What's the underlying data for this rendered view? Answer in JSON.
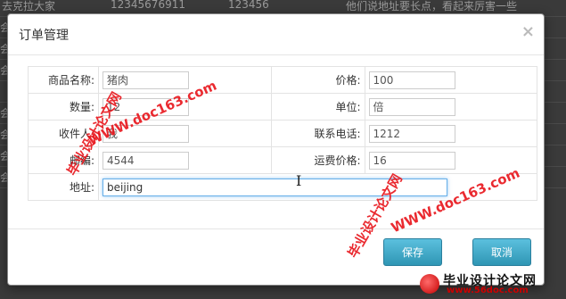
{
  "background_rows": [
    {
      "c1": "去克拉大家",
      "c2": "12345676911",
      "c3": "123456",
      "c4": "他们说地址要长点，看起来厉害一些"
    },
    {
      "c1": "会",
      "c2": "",
      "c3": "",
      "c4": ""
    },
    {
      "c1": "会",
      "c2": "",
      "c3": "",
      "c4": ""
    },
    {
      "c1": "会",
      "c2": "",
      "c3": "",
      "c4": ""
    },
    {
      "c1": "",
      "c2": "",
      "c3": "",
      "c4": ""
    },
    {
      "c1": "会",
      "c2": "",
      "c3": "",
      "c4": ""
    },
    {
      "c1": "会",
      "c2": "",
      "c3": "",
      "c4": ""
    },
    {
      "c1": "会",
      "c2": "",
      "c3": "",
      "c4": ""
    },
    {
      "c1": "会",
      "c2": "",
      "c3": "",
      "c4": ""
    }
  ],
  "modal": {
    "title": "订单管理",
    "close_glyph": "×",
    "form": {
      "product_name": {
        "label": "商品名称:",
        "value": "猪肉"
      },
      "price": {
        "label": "价格:",
        "value": "100"
      },
      "quantity": {
        "label": "数量:",
        "value": "12"
      },
      "unit": {
        "label": "单位:",
        "value": "倍"
      },
      "recipient": {
        "label": "收件人:",
        "value": "我"
      },
      "phone": {
        "label": "联系电话:",
        "value": "1212"
      },
      "postcode": {
        "label": "邮编:",
        "value": "4544"
      },
      "shipping": {
        "label": "运费价格:",
        "value": "16"
      },
      "address": {
        "label": "地址:",
        "value": "beijing"
      }
    },
    "buttons": {
      "save": "保存",
      "cancel": "取消"
    }
  },
  "watermarks": {
    "site_text": "WWW.doc163.com",
    "cn_text": "毕业设计论文网"
  },
  "brand": {
    "title": "毕业设计论文网",
    "url": "www.56doc.com",
    "color": "#cc0000"
  },
  "colors": {
    "button": "#49afcd",
    "focus_border": "#66afe9",
    "watermark": "#e8141a"
  }
}
